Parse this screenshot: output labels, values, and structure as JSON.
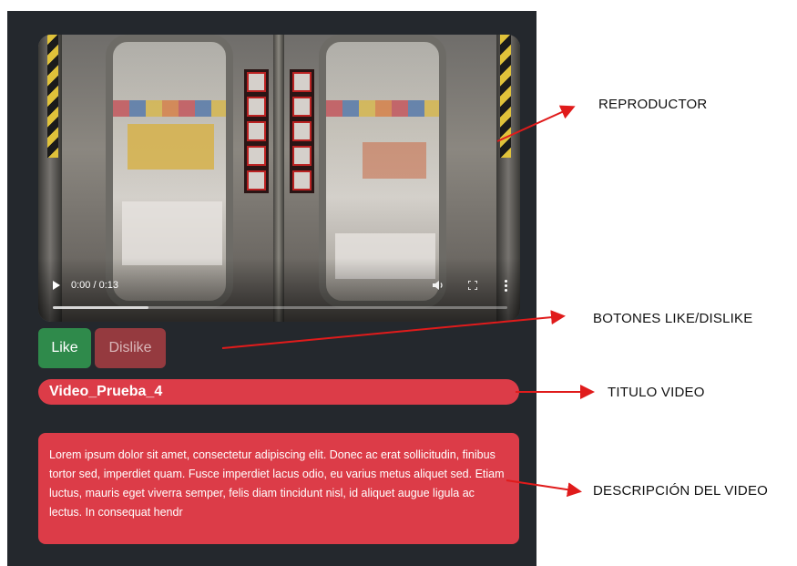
{
  "player": {
    "time": "0:00 / 0:13",
    "progress_fraction": 0.0,
    "icons": [
      "play-icon",
      "volume-icon",
      "fullscreen-icon",
      "more-icon"
    ]
  },
  "buttons": {
    "like_label": "Like",
    "dislike_label": "Dislike"
  },
  "video": {
    "title": "Video_Prueba_4",
    "description": "Lorem ipsum dolor sit amet, consectetur adipiscing elit. Donec ac erat sollicitudin, finibus tortor sed, imperdiet quam. Fusce imperdiet lacus odio, eu varius metus aliquet sed. Etiam luctus, mauris eget viverra semper, felis diam tincidunt nisl, id aliquet augue ligula ac lectus. In consequat hendr"
  },
  "annotations": {
    "player": "REPRODUCTOR",
    "buttons": "BOTONES LIKE/DISLIKE",
    "title": "TITULO VIDEO",
    "description": "DESCRIPCIÓN DEL VIDEO"
  },
  "colors": {
    "panel": "#24282d",
    "like": "#2f8a4b",
    "dislike": "#953a3f",
    "accent": "#dc3c48",
    "arrow": "#e01b1b"
  }
}
